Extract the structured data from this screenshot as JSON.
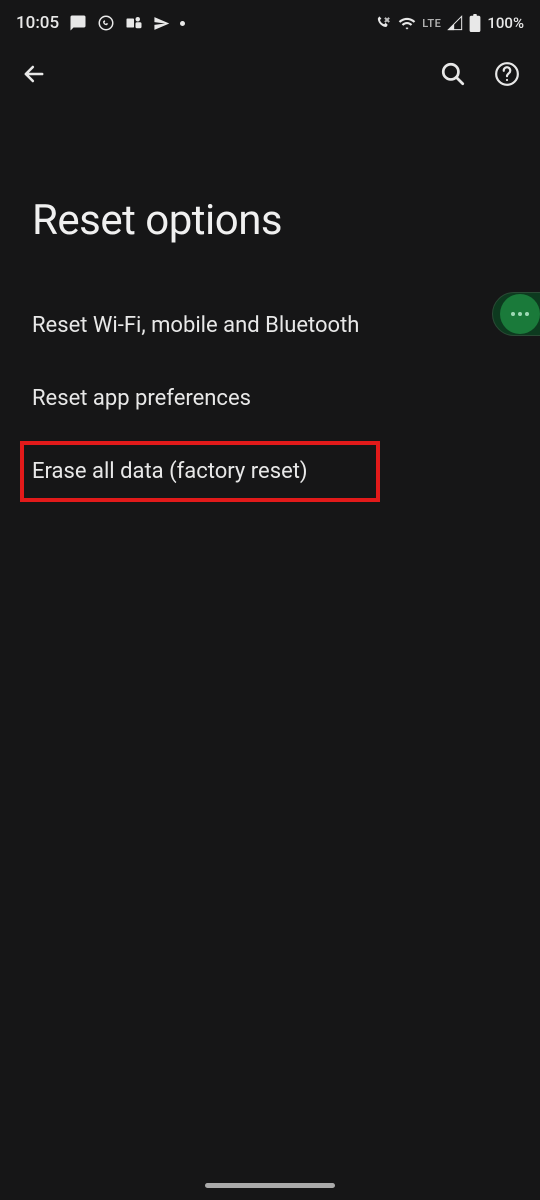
{
  "status_bar": {
    "time": "10:05",
    "battery": "100%",
    "lte": "LTE"
  },
  "page": {
    "title": "Reset options"
  },
  "options": [
    {
      "label": "Reset Wi-Fi, mobile and Bluetooth"
    },
    {
      "label": "Reset app preferences"
    },
    {
      "label": "Erase all data (factory reset)"
    }
  ]
}
